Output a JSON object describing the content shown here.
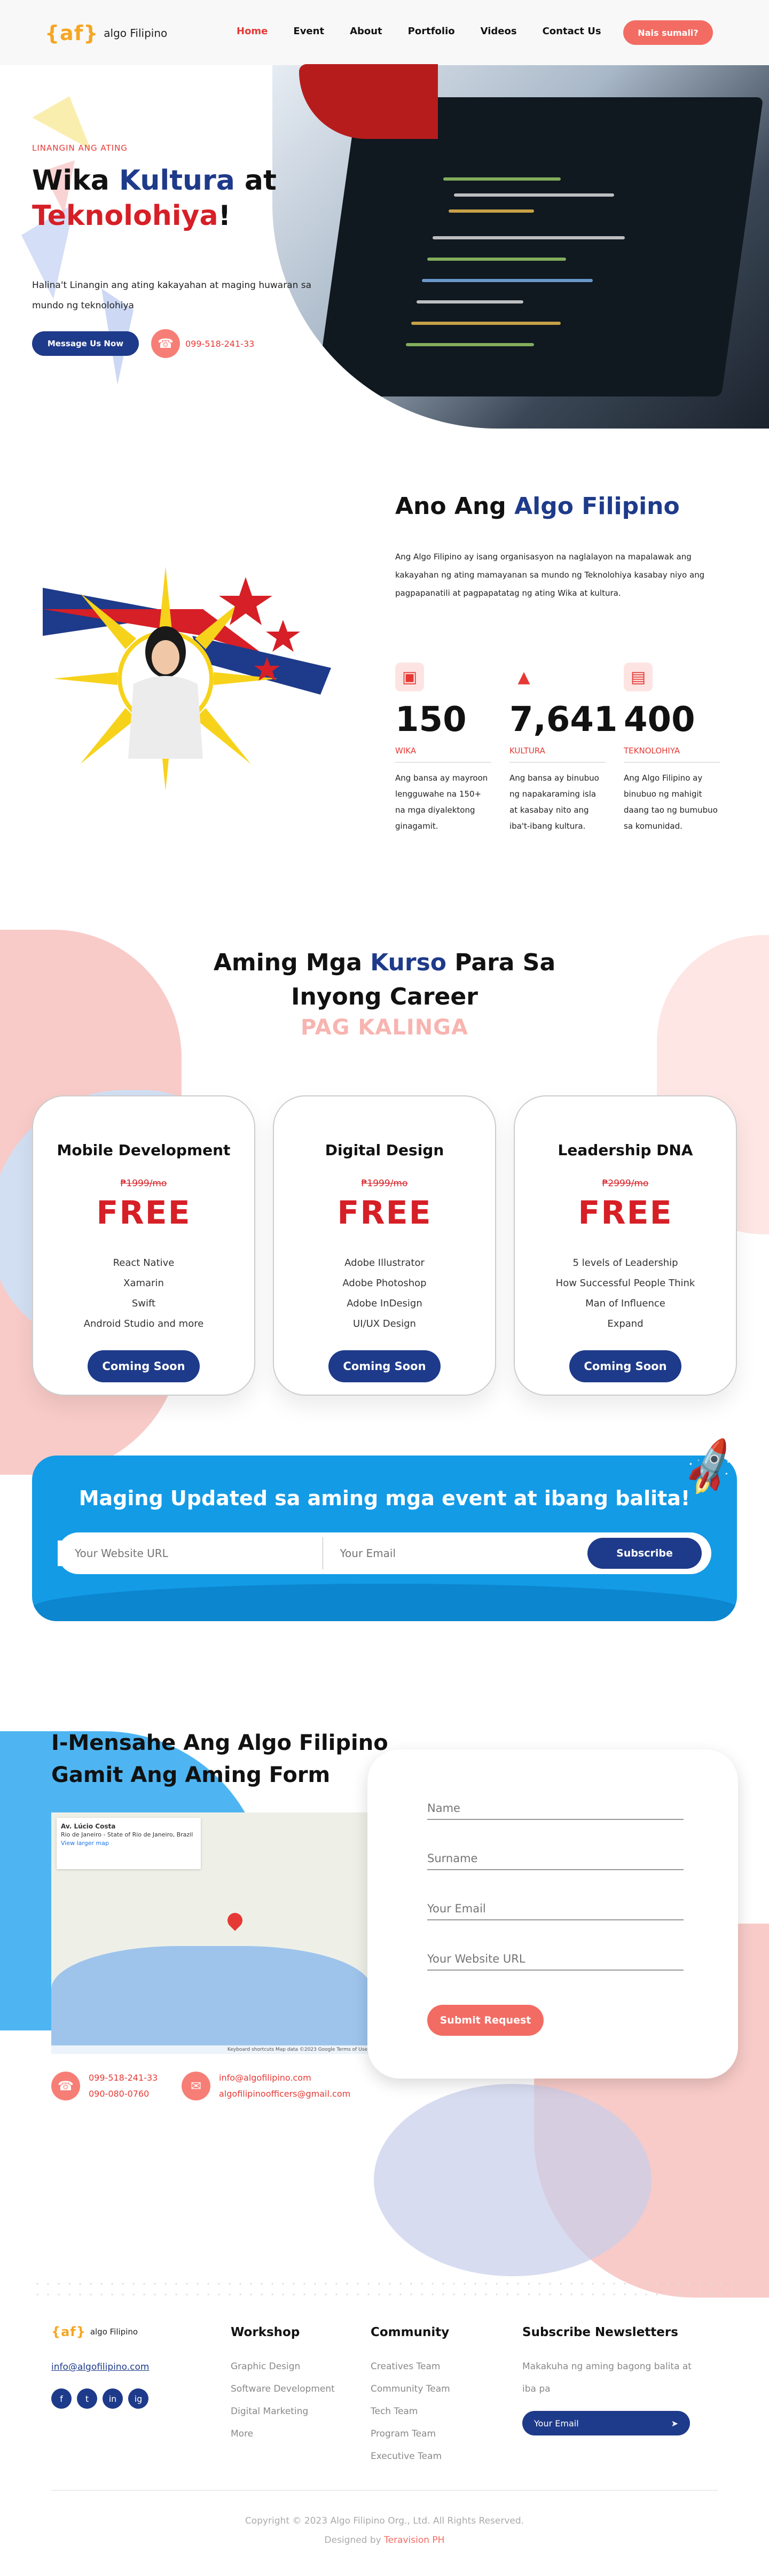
{
  "header": {
    "logo_mark": "{af}",
    "logo_text": "algo Filipino",
    "nav": [
      "Home",
      "Event",
      "About",
      "Portfolio",
      "Videos",
      "Contact Us"
    ],
    "cta": "Nais sumali?"
  },
  "hero": {
    "kicker": "LINANGIN ANG ATING",
    "title_word1": "Wika ",
    "title_word2": "Kultura",
    "title_word3": " at",
    "title_word4": "Teknolohiya",
    "title_word5": "!",
    "description": "Halina't Linangin ang ating kakayahan at maging huwaran sa mundo ng teknolohiya",
    "button": "Message Us Now",
    "phone": "099-518-241-33"
  },
  "about": {
    "title_pre": "Ano Ang ",
    "title_accent": "Algo Filipino",
    "description": "Ang Algo Filipino ay isang organisasyon na naglalayon na mapalawak ang kakayahan ng ating mamayanan sa mundo ng Teknolohiya kasabay niyo ang pagpapanatili at pagpapatatag ng ating Wika at kultura.",
    "stats": [
      {
        "icon": "book-icon",
        "value": "150",
        "label": "WIKA",
        "desc": "Ang bansa ay mayroon lengguwahe na 150+ na mga diyalektong ginagamit."
      },
      {
        "icon": "rocket-icon",
        "value": "7,641",
        "label": "KULTURA",
        "desc": "Ang bansa ay binubuo ng napakaraming isla at kasabay nito ang iba't-ibang kultura."
      },
      {
        "icon": "computer-icon",
        "value": "400",
        "label": "TEKNOLOHIYA",
        "desc": "Ang Algo Filipino ay binubuo ng mahigit daang tao ng bumubuo sa komunidad."
      }
    ]
  },
  "courses": {
    "title_pre": "Aming Mga ",
    "title_accent": "Kurso",
    "title_post": " Para Sa",
    "title_line2": "Inyong Career",
    "subtitle": "PAG KALINGA",
    "cards": [
      {
        "title": "Mobile Development",
        "old_price": "₱1999/mo",
        "price": "FREE",
        "items": [
          "React Native",
          "Xamarin",
          "Swift",
          "Android Studio and more"
        ],
        "button": "Coming Soon"
      },
      {
        "title": "Digital Design",
        "old_price": "₱1999/mo",
        "price": "FREE",
        "items": [
          "Adobe Illustrator",
          "Adobe Photoshop",
          "Adobe InDesign",
          "UI/UX Design"
        ],
        "button": "Coming Soon"
      },
      {
        "title": "Leadership DNA",
        "old_price": "₱2999/mo",
        "price": "FREE",
        "items": [
          "5 levels of Leadership",
          "How Successful People Think",
          "Man of Influence",
          "Expand"
        ],
        "button": "Coming Soon"
      }
    ]
  },
  "newsletter": {
    "title": "Maging Updated sa aming mga event at ibang balita!",
    "url_placeholder": "Your Website URL",
    "email_placeholder": "Your Email",
    "button": "Subscribe"
  },
  "contact": {
    "title": "I-Mensahe Ang Algo Filipino Gamit Ang Aming Form",
    "map_place": "Av. Lúcio Costa",
    "map_address": "Rio de Janeiro - State of Rio de Janeiro, Brazil",
    "map_link": "View larger map",
    "map_footer": "Keyboard shortcuts   Map data ©2023 Google   Terms of Use",
    "form": {
      "name": "Name",
      "surname": "Surname",
      "email": "Your Email",
      "website": "Your Website URL",
      "submit": "Submit Request"
    },
    "phone1": "099-518-241-33",
    "phone2": "090-080-0760",
    "email1": "info@algofilipino.com",
    "email2": "algofilipinoofficers@gmail.com"
  },
  "footer": {
    "email": "info@algofilipino.com",
    "social": [
      "f",
      "t",
      "in",
      "ig"
    ],
    "workshop_title": "Workshop",
    "workshop_links": [
      "Graphic Design",
      "Software Development",
      "Digital Marketing",
      "More"
    ],
    "community_title": "Community",
    "community_links": [
      "Creatives Team",
      "Community Team",
      "Tech Team",
      "Program Team",
      "Executive Team"
    ],
    "news_title": "Subscribe Newsletters",
    "news_desc": "Makakuha ng aming bagong balita at iba pa",
    "news_placeholder": "Your Email",
    "copyright": "Copyright © 2023 Algo Filipino Org., Ltd. All Rights Reserved.",
    "designed_by_pre": "Designed by ",
    "designed_by": "Teravision PH"
  }
}
